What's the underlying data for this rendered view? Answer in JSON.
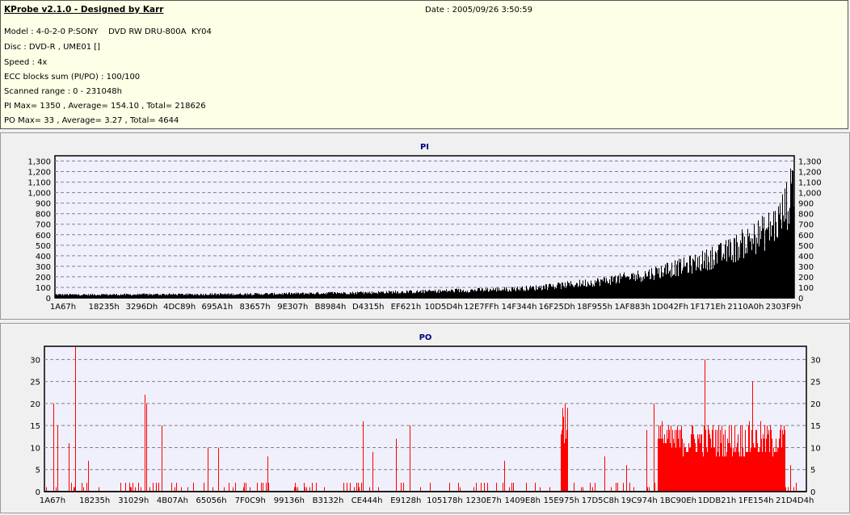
{
  "header": {
    "title": "KProbe v2.1.0 - Designed by Karr",
    "date": "Date : 2005/09/26 3:50:59",
    "lines": [
      "Model : 4-0-2-0 P:SONY    DVD RW DRU-800A  KY04",
      "Disc : DVD-R , UME01 []",
      "Speed : 4x",
      "ECC blocks sum (PI/PO) : 100/100",
      "Scanned range : 0 - 231048h",
      "PI Max= 1350 , Average= 154.10 , Total= 218626",
      "PO Max= 33 , Average= 3.27 , Total= 4644"
    ]
  },
  "colors": {
    "pi_bar": "#000000",
    "po_bar": "#ff0000",
    "plot_bg": "#f0f0fc",
    "title": "#000080"
  },
  "chart_data": [
    {
      "type": "bar",
      "title": "PI",
      "ylim": [
        0,
        1350
      ],
      "yticks": [
        0,
        100,
        200,
        300,
        400,
        500,
        600,
        700,
        800,
        900,
        1000,
        1100,
        1200,
        1300
      ],
      "ytick_labels": [
        "0",
        "100",
        "200",
        "300",
        "400",
        "500",
        "600",
        "700",
        "800",
        "900",
        "1,000",
        "1,100",
        "1,200",
        "1,300"
      ],
      "xtick_labels": [
        "1A67h",
        "18235h",
        "3296Dh",
        "4DC89h",
        "695A1h",
        "83657h",
        "9E307h",
        "B8984h",
        "D4315h",
        "EF621h",
        "10D5D4h",
        "12E7FFh",
        "14F344h",
        "16F25Dh",
        "18F955h",
        "1AF883h",
        "1D042Fh",
        "1F171Eh",
        "2110A0h",
        "2303F9h"
      ],
      "x_unit": "percent of scanned range",
      "envelope_peak_values": [
        40,
        40,
        38,
        40,
        40,
        40,
        42,
        42,
        42,
        42,
        44,
        45,
        45,
        46,
        48,
        50,
        52,
        55,
        58,
        60,
        62,
        65,
        70,
        72,
        75,
        80,
        85,
        90,
        95,
        100,
        105,
        115,
        125,
        140,
        160,
        180,
        200,
        225,
        250,
        280,
        320,
        360,
        400,
        460,
        520,
        600,
        700,
        800,
        950,
        1350
      ],
      "grid": true
    },
    {
      "type": "bar",
      "title": "PO",
      "ylim": [
        0,
        33
      ],
      "yticks": [
        0,
        5,
        10,
        15,
        20,
        25,
        30
      ],
      "ytick_labels": [
        "0",
        "5",
        "10",
        "15",
        "20",
        "25",
        "30"
      ],
      "xtick_labels": [
        "1A67h",
        "18235h",
        "31029h",
        "4B07Ah",
        "65056h",
        "7F0C9h",
        "99136h",
        "B3132h",
        "CE444h",
        "E9128h",
        "105178h",
        "1230E7h",
        "1409E8h",
        "15E975h",
        "17D5C8h",
        "19C974h",
        "1BC90Eh",
        "1DDB21h",
        "1FE154h",
        "21D4D4h"
      ],
      "x_unit": "percent of scanned range",
      "spikes": [
        [
          1.2,
          20
        ],
        [
          1.7,
          15
        ],
        [
          3.2,
          11
        ],
        [
          4.1,
          33
        ],
        [
          5.8,
          7
        ],
        [
          13.2,
          22
        ],
        [
          13.4,
          20
        ],
        [
          15.4,
          15
        ],
        [
          21.5,
          10
        ],
        [
          22.9,
          10
        ],
        [
          29.3,
          8
        ],
        [
          41.8,
          16
        ],
        [
          43.1,
          9
        ],
        [
          46.2,
          12
        ],
        [
          48.0,
          15
        ],
        [
          60.4,
          7
        ],
        [
          73.5,
          8
        ],
        [
          76.4,
          6
        ],
        [
          79.1,
          14
        ],
        [
          80.0,
          20
        ],
        [
          81.1,
          16
        ],
        [
          86.7,
          30
        ],
        [
          93.0,
          25
        ],
        [
          97.9,
          6
        ]
      ],
      "dense_regions": [
        [
          67.8,
          68.8,
          18
        ],
        [
          80.5,
          97.3,
          13
        ]
      ],
      "grid": true
    }
  ]
}
